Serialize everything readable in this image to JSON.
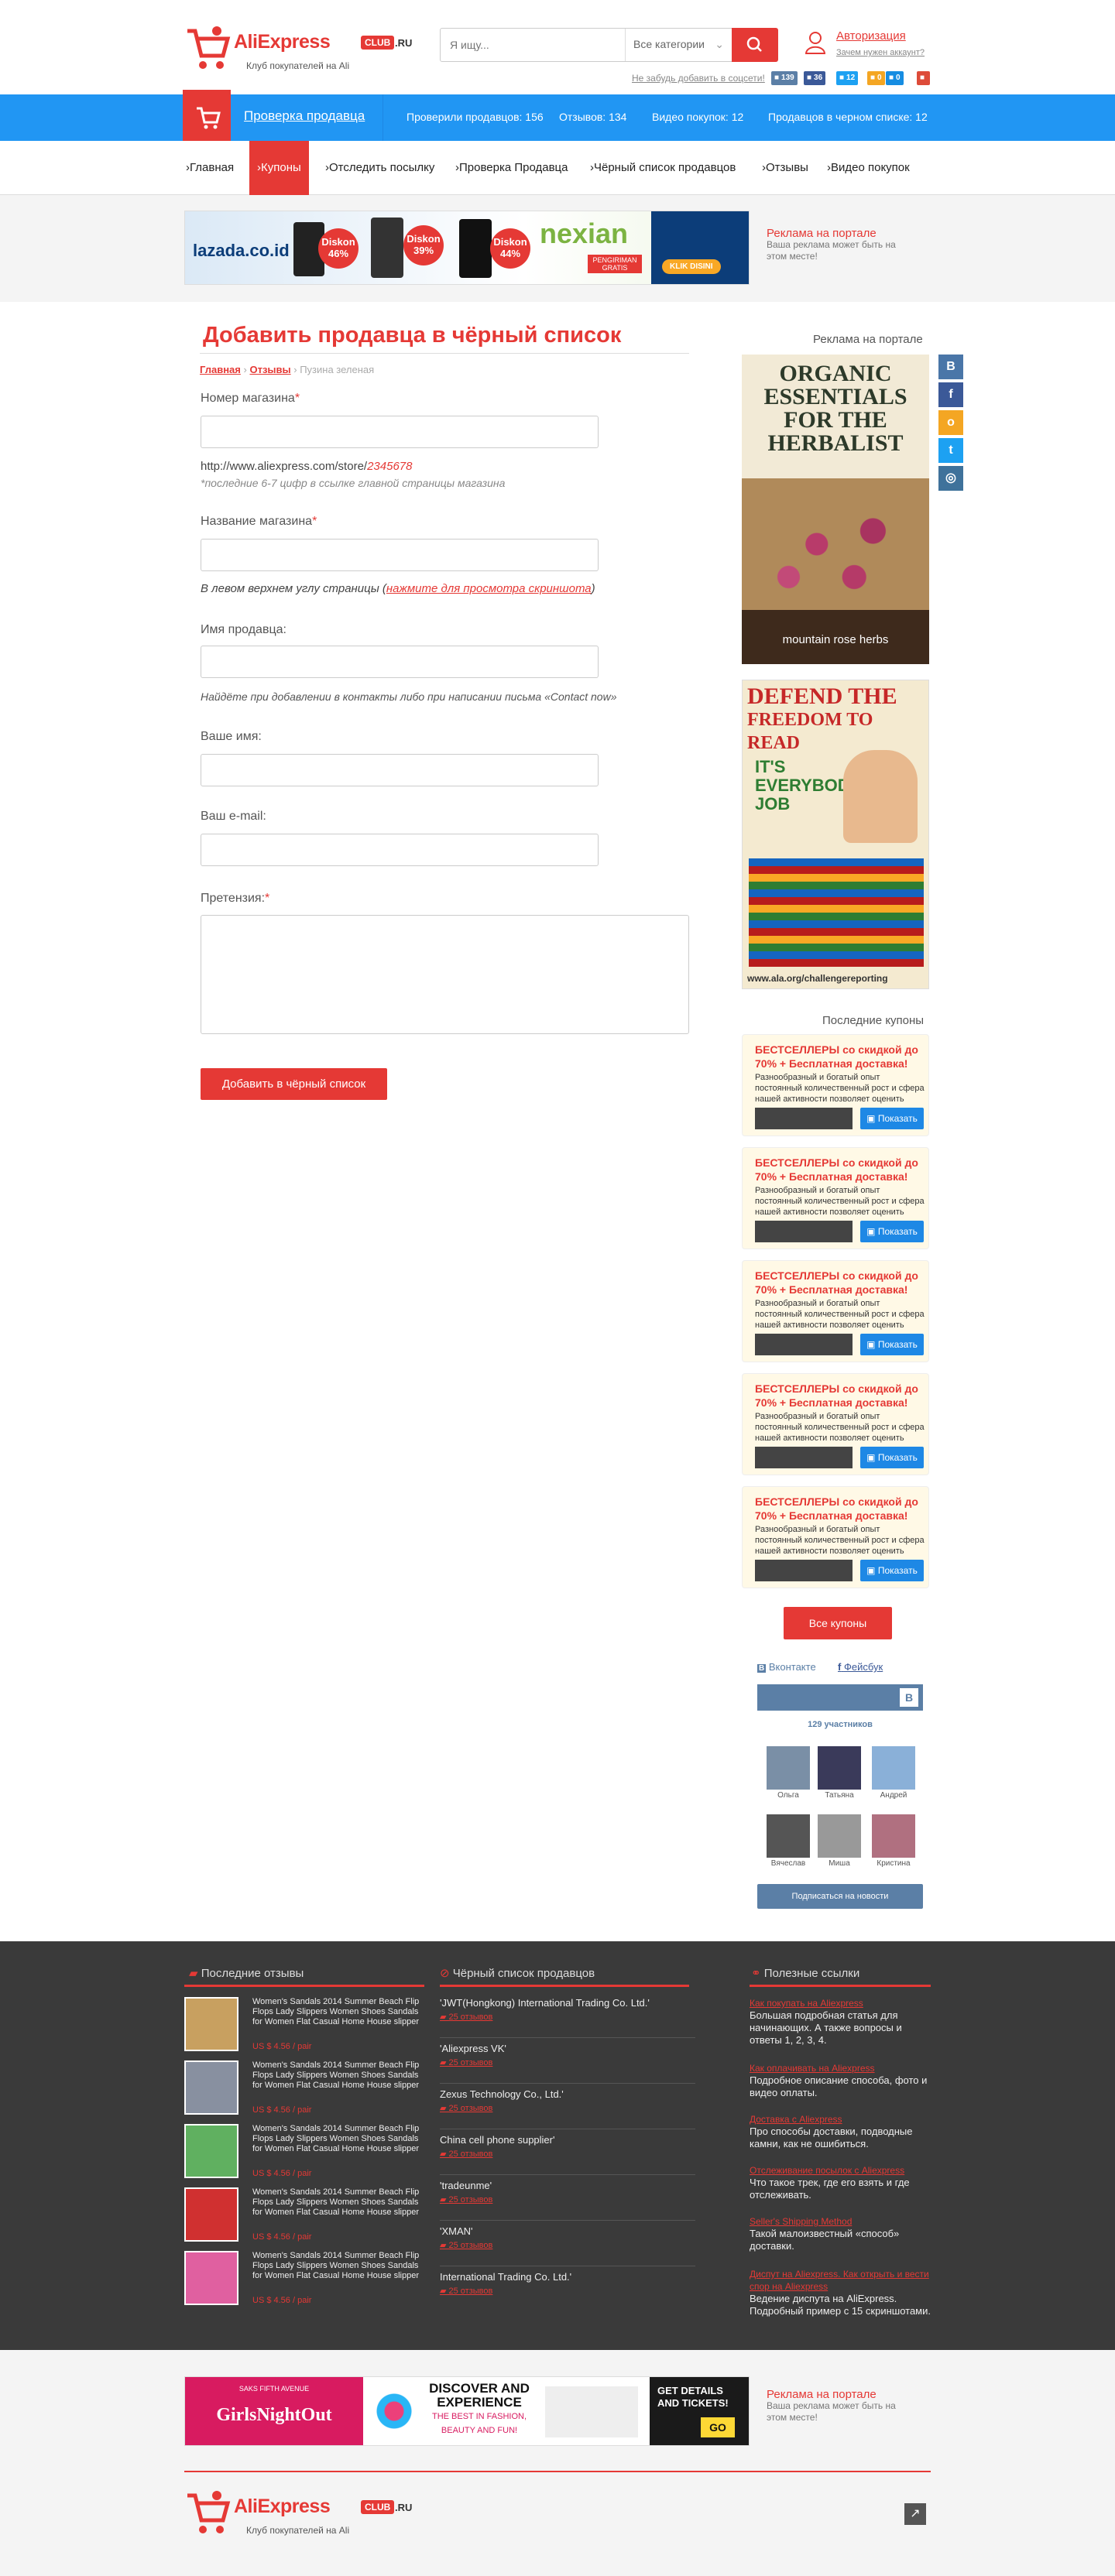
{
  "header": {
    "logo": {
      "name": "AliExpress",
      "club": "CLUB",
      "tld": ".RU",
      "tagline": "Клуб покупателей на Ali"
    },
    "search": {
      "placeholder": "Я ищу...",
      "category": "Все категории"
    },
    "auth": {
      "login": "Авторизация",
      "why": "Зачем нужен аккаунт?"
    },
    "social_hint": "Не забудь добавить в соцсети!",
    "social": [
      {
        "icon": "vk",
        "count": "139",
        "color": "#5b7fa6"
      },
      {
        "icon": "facebook",
        "count": "36",
        "color": "#3b5998"
      },
      {
        "icon": "twitter",
        "count": "12",
        "color": "#1da1f2"
      },
      {
        "icon": "odnoklassniki",
        "count": "0",
        "color": "#f4a623"
      },
      {
        "icon": "mailru",
        "count": "0",
        "color": "#168de2"
      },
      {
        "icon": "google-plus",
        "count": "",
        "color": "#dd4b39"
      }
    ]
  },
  "bluebar": {
    "title": "Проверка продавца",
    "stats": [
      "Проверили продавцов: 156",
      "Отзывов: 134",
      "Видео покупок: 12",
      "Продавцов в черном списке: 12"
    ]
  },
  "nav": [
    "Главная",
    "Купоны",
    "Отследить посылку",
    "Проверка Продавца",
    "Чёрный список продавцов",
    "Отзывы",
    "Видео покупок"
  ],
  "nav_active": "Купоны",
  "top_ad": {
    "title": "Реклама на портале",
    "text": "Ваша реклама может быть на этом месте!",
    "banner": {
      "brand": "lazada.co.id",
      "discounts": [
        "Diskon 46%",
        "Diskon 39%",
        "Diskon 44%"
      ],
      "partner": "nexian",
      "promo": "PENGIRIMAN GRATIS",
      "cta": "KLIK DISINI"
    }
  },
  "page": {
    "title": "Добавить продавца в чёрный список",
    "breadcrumb": [
      "Главная",
      "Отзывы",
      "Пузина зеленая"
    ],
    "fields": {
      "store_number": "Номер магазина",
      "store_url": "http://www.aliexpress.com/store/",
      "store_id": "2345678",
      "store_hint": "*последние 6-7 цифр в ссылке главной страницы магазина",
      "store_name": "Название магазина",
      "store_name_hint": "В левом верхнем углу страницы (",
      "store_name_link": "нажмите для просмотра скриншота",
      "store_name_hint_end": ")",
      "seller_name": "Имя продавца:",
      "seller_hint": "Найдёте при добавлении в контакты либо при написании письма «Contact now»",
      "your_name": "Ваше имя:",
      "email": "Ваш e-mail:",
      "claim": "Претензия:",
      "required_mark": "*"
    },
    "submit": "Добавить в чёрный список"
  },
  "sidebar": {
    "ad_title": "Реклама на портале",
    "ad1": {
      "line1": "ORGANIC",
      "line2": "ESSENTIALS",
      "line3": "FOR THE",
      "line4": "HERBALIST",
      "brand": "mountain rose herbs"
    },
    "ad2": {
      "line1": "DEFEND THE",
      "line2": "FREEDOM TO READ",
      "line3": "IT'S",
      "line4": "EVERYBODY'S",
      "line5": "JOB",
      "url": "www.ala.org/challengereporting"
    },
    "share": [
      {
        "icon": "vk",
        "glyph": "В",
        "color": "#4a76a8"
      },
      {
        "icon": "facebook",
        "glyph": "f",
        "color": "#3b5998"
      },
      {
        "icon": "odnoklassniki",
        "glyph": "о",
        "color": "#f4a623"
      },
      {
        "icon": "twitter",
        "glyph": "t",
        "color": "#1da1f2"
      },
      {
        "icon": "instagram",
        "glyph": "◎",
        "color": "#3f729b"
      }
    ],
    "coupons_title": "Последние купоны",
    "coupons": [
      {
        "title": "БЕСТСЕЛЛЕРЫ со скидкой до 70% + Бесплатная доставка!",
        "desc": "Разнообразный и богатый опыт постоянный количественный рост и сфера нашей активности позволяет оценить",
        "button": "Показать"
      },
      {
        "title": "БЕСТСЕЛЛЕРЫ со скидкой до 70% + Бесплатная доставка!",
        "desc": "Разнообразный и богатый опыт постоянный количественный рост и сфера нашей активности позволяет оценить",
        "button": "Показать"
      },
      {
        "title": "БЕСТСЕЛЛЕРЫ со скидкой до 70% + Бесплатная доставка!",
        "desc": "Разнообразный и богатый опыт постоянный количественный рост и сфера нашей активности позволяет оценить",
        "button": "Показать"
      },
      {
        "title": "БЕСТСЕЛЛЕРЫ со скидкой до 70% + Бесплатная доставка!",
        "desc": "Разнообразный и богатый опыт постоянный количественный рост и сфера нашей активности позволяет оценить",
        "button": "Показать"
      },
      {
        "title": "БЕСТСЕЛЛЕРЫ со скидкой до 70% + Бесплатная доставка!",
        "desc": "Разнообразный и богатый опыт постоянный количественный рост и сфера нашей активности позволяет оценить",
        "button": "Показать"
      }
    ],
    "all_coupons": "Все купоны",
    "social_tabs": [
      "Вконтакте",
      "Фейсбук"
    ],
    "members_count": "129 участников",
    "members": [
      "Ольга",
      "Татьяна",
      "Андрей",
      "Вячеслав",
      "Миша",
      "Кристина"
    ],
    "subscribe": "Подписаться на новости"
  },
  "footer": {
    "reviews_title": "Последние отзывы",
    "blacklist_title": "Чёрный список продавцов",
    "links_title": "Полезные ссылки",
    "reviews": [
      {
        "text": "Women's Sandals 2014 Summer Beach Flip Flops Lady Slippers Women Shoes Sandals for Women Flat Casual Home House slipper",
        "price": "US $ 4.56 / pair"
      },
      {
        "text": "Women's Sandals 2014 Summer Beach Flip Flops Lady Slippers Women Shoes Sandals for Women Flat Casual Home House slipper",
        "price": "US $ 4.56 / pair"
      },
      {
        "text": "Women's Sandals 2014 Summer Beach Flip Flops Lady Slippers Women Shoes Sandals for Women Flat Casual Home House slipper",
        "price": "US $ 4.56 / pair"
      },
      {
        "text": "Women's Sandals 2014 Summer Beach Flip Flops Lady Slippers Women Shoes Sandals for Women Flat Casual Home House slipper",
        "price": "US $ 4.56 / pair"
      },
      {
        "text": "Women's Sandals 2014 Summer Beach Flip Flops Lady Slippers Women Shoes Sandals for Women Flat Casual Home House slipper",
        "price": "US $ 4.56 / pair"
      }
    ],
    "blacklist": [
      {
        "name": "'JWT(Hongkong) International Trading Co. Ltd.'",
        "count": "25 отзывов"
      },
      {
        "name": "'Aliexpress VK'",
        "count": "25 отзывов"
      },
      {
        "name": "Zexus Technology Co., Ltd.'",
        "count": "25 отзывов"
      },
      {
        "name": "China cell phone supplier'",
        "count": "25 отзывов"
      },
      {
        "name": "'tradeunme'",
        "count": "25 отзывов"
      },
      {
        "name": "'XMAN'",
        "count": "25 отзывов"
      },
      {
        "name": "International Trading Co. Ltd.'",
        "count": "25 отзывов"
      }
    ],
    "links": [
      {
        "title": "Как покупать на Aliexpress",
        "desc": "Большая подробная статья для начинающих. А также вопросы и ответы 1, 2, 3, 4."
      },
      {
        "title": "Как оплачивать на Aliexpress",
        "desc": "Подробное описание способа, фото и видео оплаты."
      },
      {
        "title": "Доставка с Aliexpress",
        "desc": "Про способы доставки, подводные камни, как не ошибиться."
      },
      {
        "title": "Отслеживание посылок с Aliexpress",
        "desc": "Что такое трек, где его взять и где отслеживать."
      },
      {
        "title": "Seller's Shipping Method",
        "desc": "Такой малоизвестный «способ» доставки."
      },
      {
        "title": "Диспут на Aliexpress. Как открыть и вести спор на Aliexpress",
        "desc": "Ведение диспута на AliExpress. Подробный пример с 15 скриншотами."
      }
    ]
  },
  "bottom_ad": {
    "title": "Реклама на портале",
    "text": "Ваша реклама может быть на этом месте!",
    "banner": {
      "brand": "SAKS FIFTH AVENUE",
      "event": "GirlsNightOut",
      "headline1": "DISCOVER AND",
      "headline2": "EXPERIENCE",
      "sub1": "THE BEST IN FASHION,",
      "sub2": "BEAUTY AND FUN!",
      "cta1": "GET DETAILS",
      "cta2": "AND TICKETS!",
      "go": "GO"
    }
  },
  "bottom_logo": {
    "name": "AliExpress",
    "club": "CLUB",
    "tld": ".RU",
    "tagline": "Клуб покупателей на Ali"
  },
  "colors": {
    "accent": "#e53935",
    "blue": "#2196f3",
    "footer_bg": "#3a3a3a"
  }
}
